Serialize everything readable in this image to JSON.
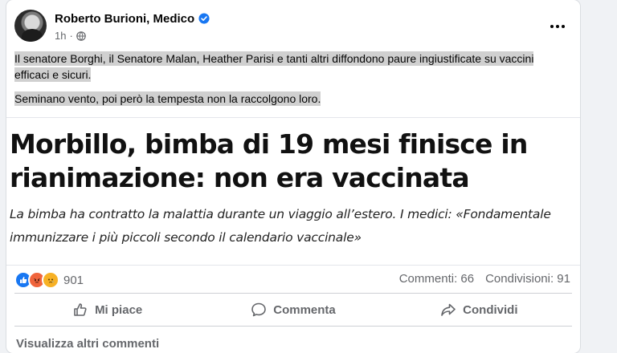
{
  "post": {
    "author": "Roberto Burioni, Medico",
    "time": "1h",
    "separator": "·",
    "paragraph1": "Il senatore Borghi, il Senatore Malan, Heather Parisi e tanti altri diffondono paure ingiustificate su vaccini efficaci e sicuri.",
    "paragraph2": "Seminano vento, poi però la tempesta non la raccolgono loro."
  },
  "article": {
    "headline": "Morbillo, bimba di 19 mesi finisce in rianimazione: non era vaccinata",
    "subheadline": "La bimba ha contratto la malattia durante un viaggio all’estero. I medici: «Fondamentale immunizzare i più piccoli secondo il calendario vaccinale»"
  },
  "stats": {
    "reaction_count": "901",
    "comments": "Commenti: 66",
    "shares": "Condivisioni: 91",
    "reaction_icons": [
      "like-icon",
      "angry-icon",
      "sad-icon"
    ]
  },
  "actions": {
    "like": "Mi piace",
    "comment": "Commenta",
    "share": "Condividi"
  },
  "comments_link": "Visualizza altri commenti",
  "colors": {
    "like": "#1877f2",
    "angry": "#f0643c",
    "sad": "#f7b125",
    "secondary_text": "#65676b",
    "highlight": "#d0d0d0"
  }
}
